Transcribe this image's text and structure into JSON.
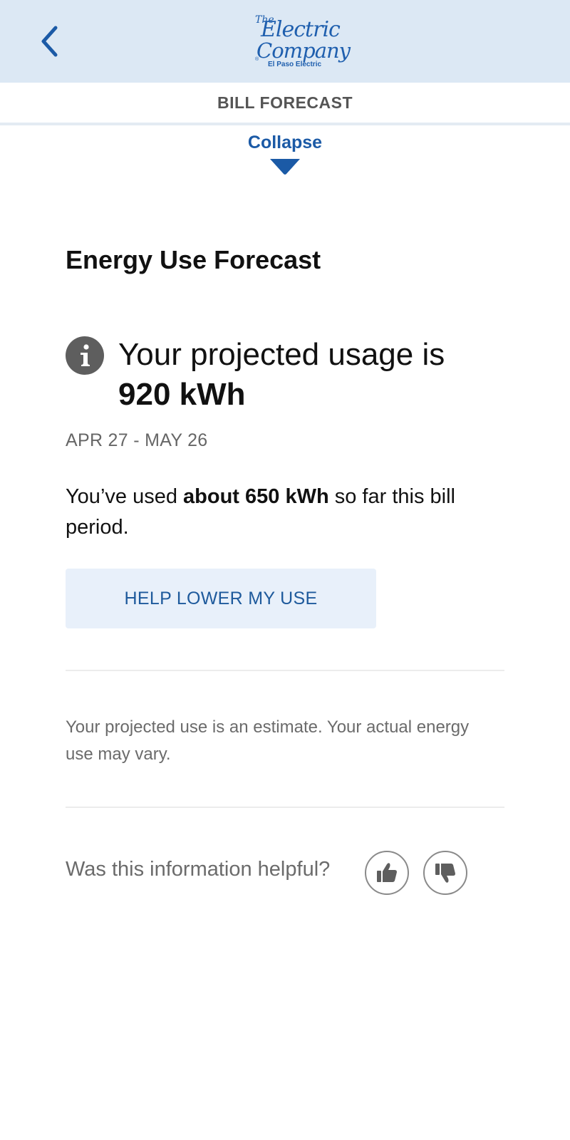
{
  "header": {
    "back_icon": "chevron-left-icon",
    "logo": {
      "the": "The",
      "line1": "Electric",
      "line2": "Company",
      "reg": "®",
      "sub": "El Paso Electric"
    }
  },
  "title_bar": {
    "title": "BILL FORECAST"
  },
  "collapse": {
    "label": "Collapse",
    "icon": "triangle-down-icon"
  },
  "forecast": {
    "section_title": "Energy Use Forecast",
    "info_icon": "info-icon",
    "projected_prefix": "Your projected usage is",
    "projected_value": "920 kWh",
    "date_range": "APR 27 - MAY 26",
    "usage_prefix": "You’ve used ",
    "usage_value": "about 650 kWh",
    "usage_suffix": " so far this bill period.",
    "help_button": "HELP LOWER MY USE",
    "disclaimer": "Your projected use is an estimate. Your actual energy use may vary."
  },
  "feedback": {
    "question": "Was this information helpful?",
    "thumbs_up_icon": "thumbs-up-icon",
    "thumbs_down_icon": "thumbs-down-icon"
  },
  "colors": {
    "header_bg": "#dce8f4",
    "brand_blue": "#1b5aa6",
    "button_bg": "#e8f0fa",
    "icon_gray": "#5e5e5e"
  }
}
